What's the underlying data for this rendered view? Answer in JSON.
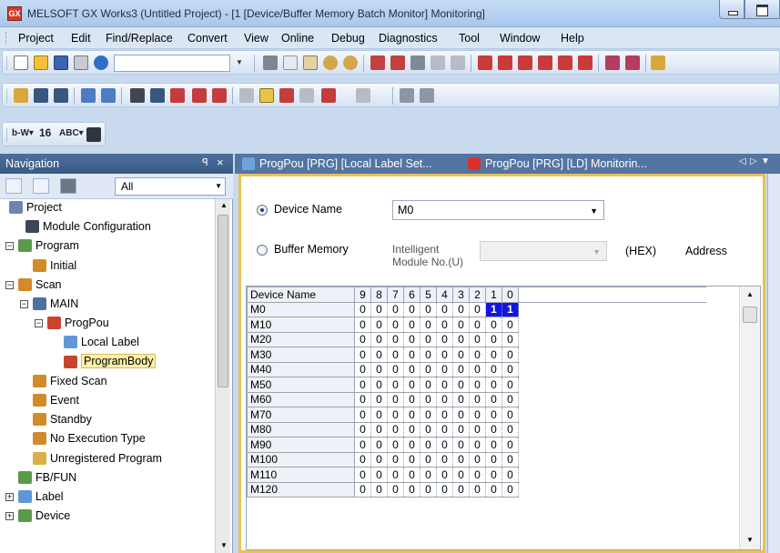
{
  "window": {
    "title": "MELSOFT GX Works3 (Untitled Project) - [1 [Device/Buffer Memory Batch Monitor] Monitoring]",
    "app_icon_text": "GX"
  },
  "menu": [
    "Project",
    "Edit",
    "Find/Replace",
    "Convert",
    "View",
    "Online",
    "Debug",
    "Diagnostics",
    "Tool",
    "Window",
    "Help"
  ],
  "toolbar_texts": {
    "bit_text": "b-W▾",
    "bit16": "16",
    "abc": "ABC▾"
  },
  "navigation": {
    "title": "Navigation",
    "pin": "ꟼ",
    "close": "×",
    "filter_value": "All",
    "tree": [
      {
        "label": "Project",
        "icon": "project-icon"
      },
      {
        "label": "Module Configuration",
        "icon": "module-config-icon"
      },
      {
        "label": "Program",
        "icon": "program-folder-icon",
        "expander": "−"
      },
      {
        "label": "Initial",
        "icon": "program-type-icon"
      },
      {
        "label": "Scan",
        "icon": "program-type-icon",
        "expander": "−"
      },
      {
        "label": "MAIN",
        "icon": "task-icon",
        "expander": "−"
      },
      {
        "label": "ProgPou",
        "icon": "pou-icon",
        "expander": "−"
      },
      {
        "label": "Local Label",
        "icon": "local-label-icon"
      },
      {
        "label": "ProgramBody",
        "icon": "program-body-icon",
        "selected": true
      },
      {
        "label": "Fixed Scan",
        "icon": "program-type-icon"
      },
      {
        "label": "Event",
        "icon": "program-type-icon"
      },
      {
        "label": "Standby",
        "icon": "program-type-icon"
      },
      {
        "label": "No Execution Type",
        "icon": "program-type-icon"
      },
      {
        "label": "Unregistered Program",
        "icon": "unregistered-icon"
      },
      {
        "label": "FB/FUN",
        "icon": "fbfun-icon"
      },
      {
        "label": "Label",
        "icon": "label-icon",
        "expander": "+"
      },
      {
        "label": "Device",
        "icon": "device-icon",
        "expander": "+"
      }
    ]
  },
  "tabs": [
    {
      "label": "ProgPou [PRG] [Local Label Set...",
      "icon": "label-setting-icon"
    },
    {
      "label": "ProgPou [PRG] [LD] Monitorin...",
      "icon": "ladder-icon"
    }
  ],
  "monitor": {
    "device_name_label": "Device Name",
    "device_name_value": "M0",
    "buffer_memory_label": "Buffer Memory",
    "intelligent_label_1": "Intelligent",
    "intelligent_label_2": "Module No.(U)",
    "hex_label": "(HEX)",
    "address_label": "Address",
    "selected_mode": "device_name"
  },
  "grid": {
    "header": [
      "Device Name",
      "9",
      "8",
      "7",
      "6",
      "5",
      "4",
      "3",
      "2",
      "1",
      "0"
    ],
    "rows": [
      {
        "name": "M0",
        "bits": [
          "0",
          "0",
          "0",
          "0",
          "0",
          "0",
          "0",
          "0",
          "1",
          "1"
        ],
        "on": [
          8,
          9
        ]
      },
      {
        "name": "M10",
        "bits": [
          "0",
          "0",
          "0",
          "0",
          "0",
          "0",
          "0",
          "0",
          "0",
          "0"
        ]
      },
      {
        "name": "M20",
        "bits": [
          "0",
          "0",
          "0",
          "0",
          "0",
          "0",
          "0",
          "0",
          "0",
          "0"
        ]
      },
      {
        "name": "M30",
        "bits": [
          "0",
          "0",
          "0",
          "0",
          "0",
          "0",
          "0",
          "0",
          "0",
          "0"
        ]
      },
      {
        "name": "M40",
        "bits": [
          "0",
          "0",
          "0",
          "0",
          "0",
          "0",
          "0",
          "0",
          "0",
          "0"
        ]
      },
      {
        "name": "M50",
        "bits": [
          "0",
          "0",
          "0",
          "0",
          "0",
          "0",
          "0",
          "0",
          "0",
          "0"
        ]
      },
      {
        "name": "M60",
        "bits": [
          "0",
          "0",
          "0",
          "0",
          "0",
          "0",
          "0",
          "0",
          "0",
          "0"
        ]
      },
      {
        "name": "M70",
        "bits": [
          "0",
          "0",
          "0",
          "0",
          "0",
          "0",
          "0",
          "0",
          "0",
          "0"
        ]
      },
      {
        "name": "M80",
        "bits": [
          "0",
          "0",
          "0",
          "0",
          "0",
          "0",
          "0",
          "0",
          "0",
          "0"
        ]
      },
      {
        "name": "M90",
        "bits": [
          "0",
          "0",
          "0",
          "0",
          "0",
          "0",
          "0",
          "0",
          "0",
          "0"
        ]
      },
      {
        "name": "M100",
        "bits": [
          "0",
          "0",
          "0",
          "0",
          "0",
          "0",
          "0",
          "0",
          "0",
          "0"
        ]
      },
      {
        "name": "M110",
        "bits": [
          "0",
          "0",
          "0",
          "0",
          "0",
          "0",
          "0",
          "0",
          "0",
          "0"
        ]
      },
      {
        "name": "M120",
        "bits": [
          "0",
          "0",
          "0",
          "0",
          "0",
          "0",
          "0",
          "0",
          "0",
          "0"
        ]
      }
    ]
  },
  "colors": {
    "bit_on": "#1414e0",
    "panel_border": "#e8c352",
    "nav_header": "#3a5a86",
    "selected_item": "#fff0a8"
  }
}
